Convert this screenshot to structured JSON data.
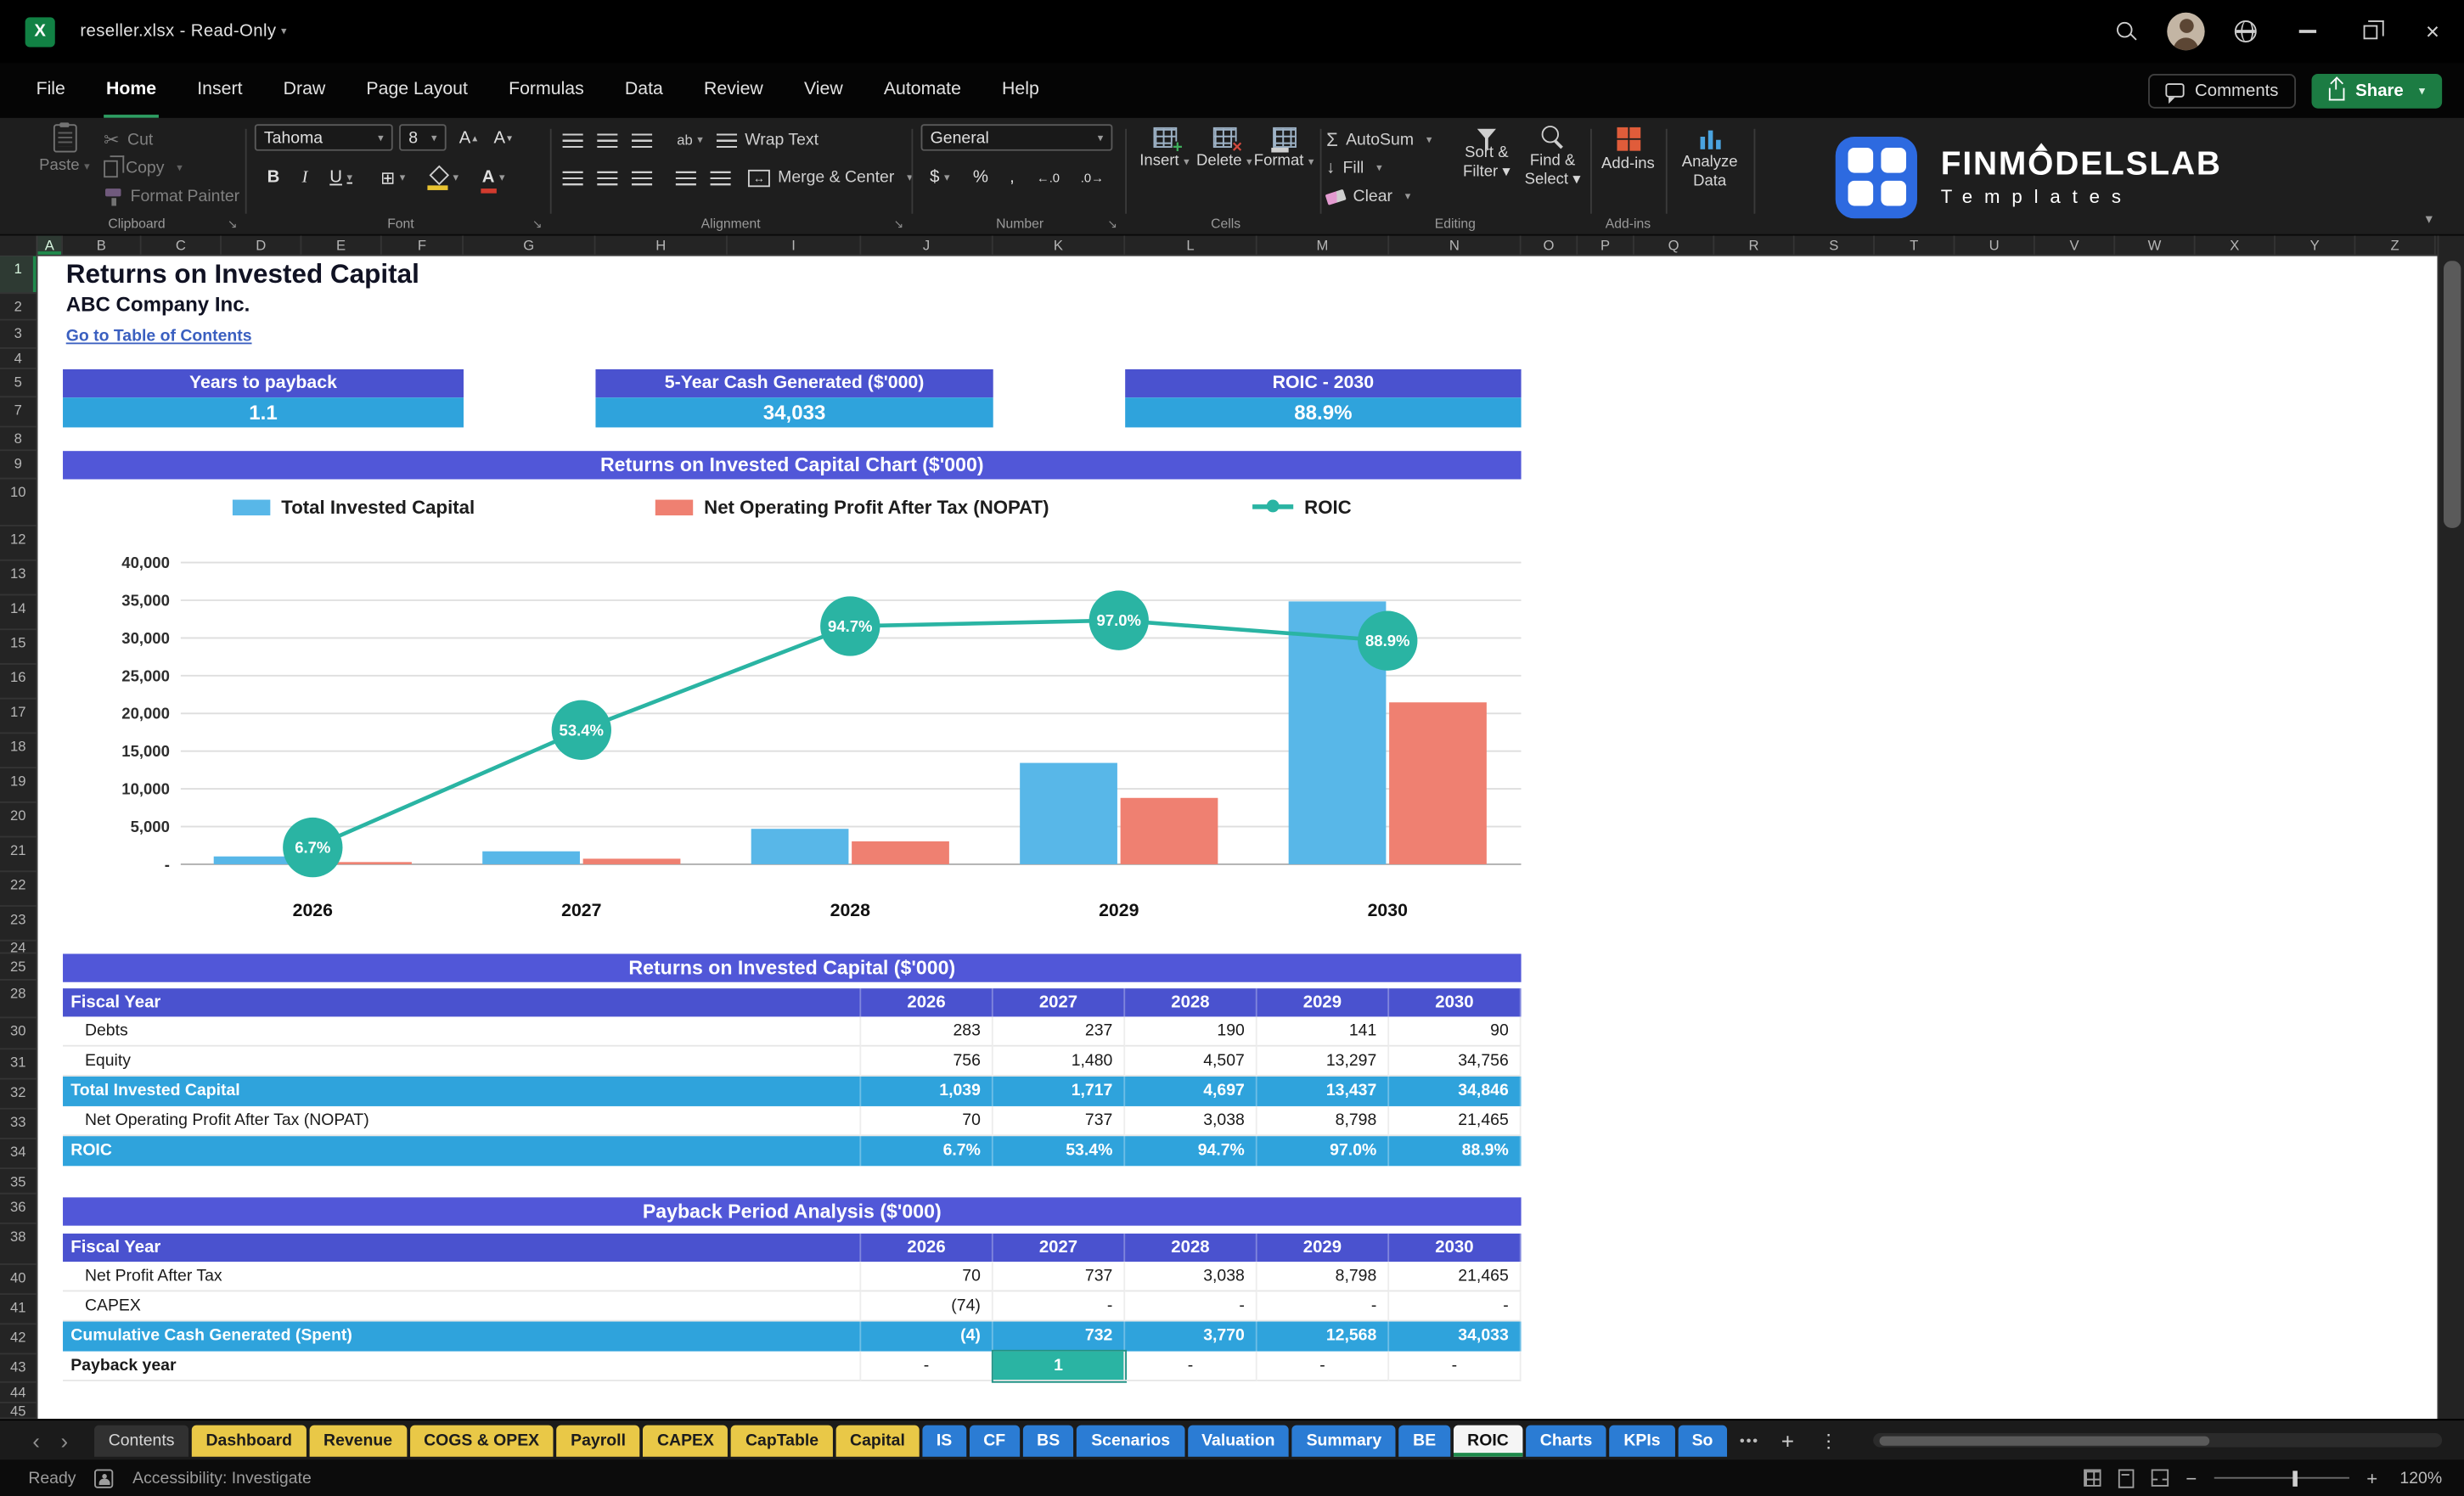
{
  "colors": {
    "accent_green": "#1f8a4c",
    "header_purple": "#5157d8",
    "subheader_purple": "#4a52cf",
    "value_blue": "#2fa3dc",
    "bar_blue": "#58b7e8",
    "bar_red": "#ef8071",
    "teal": "#2ab4a3",
    "tab_yellow": "#e9c847",
    "tab_blue": "#2b7cd4",
    "link_blue": "#3a5fc0"
  },
  "window": {
    "title": "reseller.xlsx  -  Read-Only"
  },
  "menubar": {
    "tabs": [
      "File",
      "Home",
      "Insert",
      "Draw",
      "Page Layout",
      "Formulas",
      "Data",
      "Review",
      "View",
      "Automate",
      "Help"
    ],
    "active_tab": "Home",
    "comments_label": "Comments",
    "share_label": "Share"
  },
  "ribbon": {
    "paste": "Paste",
    "cut": "Cut",
    "copy": "Copy",
    "format_painter": "Format Painter",
    "clipboard_group": "Clipboard",
    "font_family": "Tahoma",
    "font_size": "8",
    "font_group": "Font",
    "wrap_text": "Wrap Text",
    "merge_center": "Merge & Center",
    "alignment_group": "Alignment",
    "number_format": "General",
    "number_group": "Number",
    "insert": "Insert",
    "delete": "Delete",
    "format": "Format",
    "cells_group": "Cells",
    "autosum": "AutoSum",
    "fill": "Fill",
    "clear": "Clear",
    "sort_filter": "Sort & Filter",
    "find_select": "Find & Select",
    "editing_group": "Editing",
    "addins_label": "Add-ins",
    "addins_group": "Add-ins",
    "analyze_data": "Analyze Data",
    "brand": "FINMODELSLAB",
    "brand_sub": "Templates"
  },
  "grid": {
    "columns": [
      "A",
      "B",
      "C",
      "D",
      "E",
      "F",
      "G",
      "H",
      "I",
      "J",
      "K",
      "L",
      "M",
      "N",
      "O",
      "P",
      "Q",
      "R",
      "S",
      "T",
      "U",
      "V",
      "W",
      "X",
      "Y",
      "Z"
    ],
    "rows": [
      1,
      2,
      3,
      4,
      5,
      7,
      8,
      9,
      10,
      12,
      13,
      14,
      15,
      16,
      17,
      18,
      19,
      20,
      21,
      22,
      23,
      24,
      25,
      28,
      30,
      31,
      32,
      33,
      34,
      35,
      36,
      38,
      40,
      41,
      42,
      43,
      44,
      45
    ]
  },
  "sheet": {
    "title": "Returns on Invested Capital",
    "company": "ABC Company Inc.",
    "link": "Go to Table of Contents",
    "kpis": [
      {
        "label": "Years to payback",
        "value": "1.1"
      },
      {
        "label": "5-Year Cash Generated ($'000)",
        "value": "34,033"
      },
      {
        "label": "ROIC - 2030",
        "value": "88.9%"
      }
    ]
  },
  "chart_data": {
    "type": "bar",
    "title": "Returns on Invested Capital Chart ($'000)",
    "categories": [
      "2026",
      "2027",
      "2028",
      "2029",
      "2030"
    ],
    "series": [
      {
        "name": "Total Invested Capital",
        "type": "bar",
        "values": [
          1039,
          1717,
          4697,
          13437,
          34846
        ]
      },
      {
        "name": "Net Operating Profit After Tax (NOPAT)",
        "type": "bar",
        "values": [
          70,
          737,
          3038,
          8798,
          21465
        ]
      },
      {
        "name": "ROIC",
        "type": "line",
        "axis": "secondary",
        "values": [
          6.7,
          53.4,
          94.7,
          97.0,
          88.9
        ],
        "point_labels": [
          "6.7%",
          "53.4%",
          "94.7%",
          "97.0%",
          "88.9%"
        ]
      }
    ],
    "primary_axis": {
      "min": 0,
      "max": 40000,
      "step": 5000,
      "tick_labels": [
        "-",
        "5,000",
        "10,000",
        "15,000",
        "20,000",
        "25,000",
        "30,000",
        "35,000",
        "40,000"
      ]
    },
    "secondary_axis": {
      "min": 0,
      "max": 120,
      "unit": "%"
    },
    "legend_position": "top",
    "grid": true
  },
  "tables": [
    {
      "title": "Returns on Invested Capital ($'000)",
      "header": [
        "Fiscal Year",
        "2026",
        "2027",
        "2028",
        "2029",
        "2030"
      ],
      "rows": [
        {
          "label": "Debts",
          "style": "plain",
          "values": [
            "283",
            "237",
            "190",
            "141",
            "90"
          ]
        },
        {
          "label": "Equity",
          "style": "plain",
          "values": [
            "756",
            "1,480",
            "4,507",
            "13,297",
            "34,756"
          ]
        },
        {
          "label": "Total Invested Capital",
          "style": "total",
          "values": [
            "1,039",
            "1,717",
            "4,697",
            "13,437",
            "34,846"
          ]
        },
        {
          "label": "Net Operating Profit After Tax (NOPAT)",
          "style": "plain",
          "values": [
            "70",
            "737",
            "3,038",
            "8,798",
            "21,465"
          ]
        },
        {
          "label": "ROIC",
          "style": "total",
          "values": [
            "6.7%",
            "53.4%",
            "94.7%",
            "97.0%",
            "88.9%"
          ]
        }
      ]
    },
    {
      "title": "Payback Period Analysis ($'000)",
      "header": [
        "Fiscal Year",
        "2026",
        "2027",
        "2028",
        "2029",
        "2030"
      ],
      "rows": [
        {
          "label": "Net Profit After Tax",
          "style": "plain",
          "values": [
            "70",
            "737",
            "3,038",
            "8,798",
            "21,465"
          ]
        },
        {
          "label": "CAPEX",
          "style": "plain",
          "values": [
            "(74)",
            "-",
            "-",
            "-",
            "-"
          ]
        },
        {
          "label": "Cumulative Cash Generated (Spent)",
          "style": "total",
          "values": [
            "(4)",
            "732",
            "3,770",
            "12,568",
            "34,033"
          ]
        },
        {
          "label": "Payback year",
          "style": "payback",
          "values": [
            "-",
            "1",
            "-",
            "-",
            "-"
          ],
          "highlight_index": 1
        }
      ]
    }
  ],
  "sheet_tabs": {
    "tabs": [
      {
        "label": "Contents",
        "color": "dark"
      },
      {
        "label": "Dashboard",
        "color": "yellow"
      },
      {
        "label": "Revenue",
        "color": "yellow"
      },
      {
        "label": "COGS & OPEX",
        "color": "yellow"
      },
      {
        "label": "Payroll",
        "color": "yellow"
      },
      {
        "label": "CAPEX",
        "color": "yellow"
      },
      {
        "label": "CapTable",
        "color": "yellow"
      },
      {
        "label": "Capital",
        "color": "yellow"
      },
      {
        "label": "IS",
        "color": "blue"
      },
      {
        "label": "CF",
        "color": "blue"
      },
      {
        "label": "BS",
        "color": "blue"
      },
      {
        "label": "Scenarios",
        "color": "blue"
      },
      {
        "label": "Valuation",
        "color": "blue"
      },
      {
        "label": "Summary",
        "color": "blue"
      },
      {
        "label": "BE",
        "color": "blue"
      },
      {
        "label": "ROIC",
        "color": "active"
      },
      {
        "label": "Charts",
        "color": "blue"
      },
      {
        "label": "KPIs",
        "color": "blue"
      },
      {
        "label": "So",
        "color": "blue"
      }
    ],
    "overflow": "•••",
    "add": "+",
    "more": "⋮"
  },
  "statusbar": {
    "ready": "Ready",
    "accessibility": "Accessibility: Investigate",
    "zoom": "120%"
  }
}
